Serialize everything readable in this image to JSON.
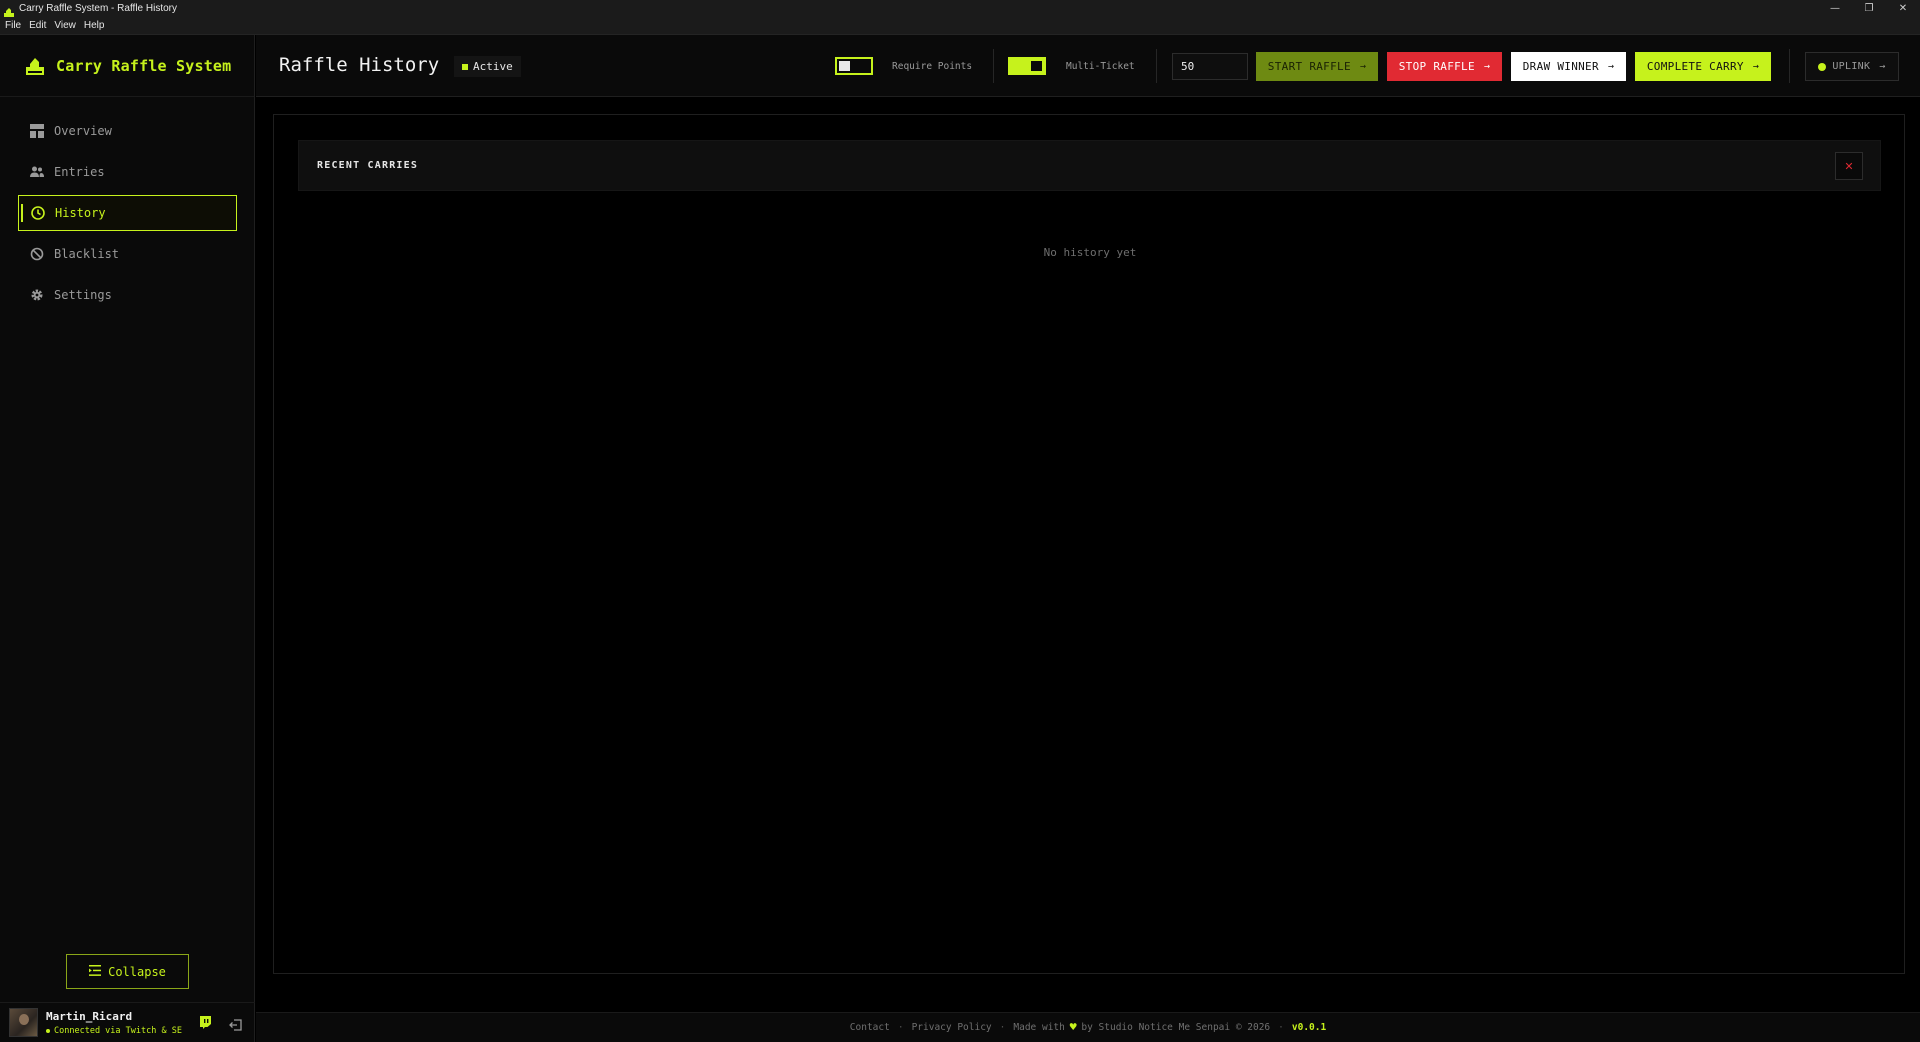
{
  "window": {
    "title": "Carry Raffle System - Raffle History",
    "minimize": "—",
    "restore": "❐",
    "close": "✕"
  },
  "menu": [
    "File",
    "Edit",
    "View",
    "Help"
  ],
  "brand": {
    "name": "Carry Raffle System"
  },
  "colors": {
    "accent": "#c6f21c",
    "danger": "#e12a33",
    "background": "#000000",
    "panel": "#0a0a0a"
  },
  "sidebar": {
    "items": [
      {
        "label": "Overview",
        "icon": "dashboard-icon",
        "active": false
      },
      {
        "label": "Entries",
        "icon": "users-icon",
        "active": false
      },
      {
        "label": "History",
        "icon": "history-icon",
        "active": true
      },
      {
        "label": "Blacklist",
        "icon": "ban-icon",
        "active": false
      },
      {
        "label": "Settings",
        "icon": "gear-icon",
        "active": false
      }
    ],
    "collapse_label": "Collapse"
  },
  "user": {
    "name": "Martin_Ricard",
    "status": "Connected via Twitch & SE"
  },
  "header": {
    "title": "Raffle History",
    "status": "Active",
    "require_points_label": "Require Points",
    "require_points_on": false,
    "multi_ticket_label": "Multi-Ticket",
    "multi_ticket_on": true,
    "ticket_value": "50",
    "start_label": "START RAFFLE",
    "stop_label": "STOP RAFFLE",
    "draw_label": "DRAW WINNER",
    "complete_label": "COMPLETE CARRY",
    "uplink_label": "UPLINK",
    "arrow": "→"
  },
  "main": {
    "card_title": "RECENT CARRIES",
    "clear_glyph": "✕",
    "empty_message": "No history yet"
  },
  "footer": {
    "contact": "Contact",
    "privacy": "Privacy Policy",
    "made_with": "Made with",
    "by": "by Studio Notice Me Senpai © 2026",
    "version": "v0.0.1",
    "separator": "·"
  }
}
